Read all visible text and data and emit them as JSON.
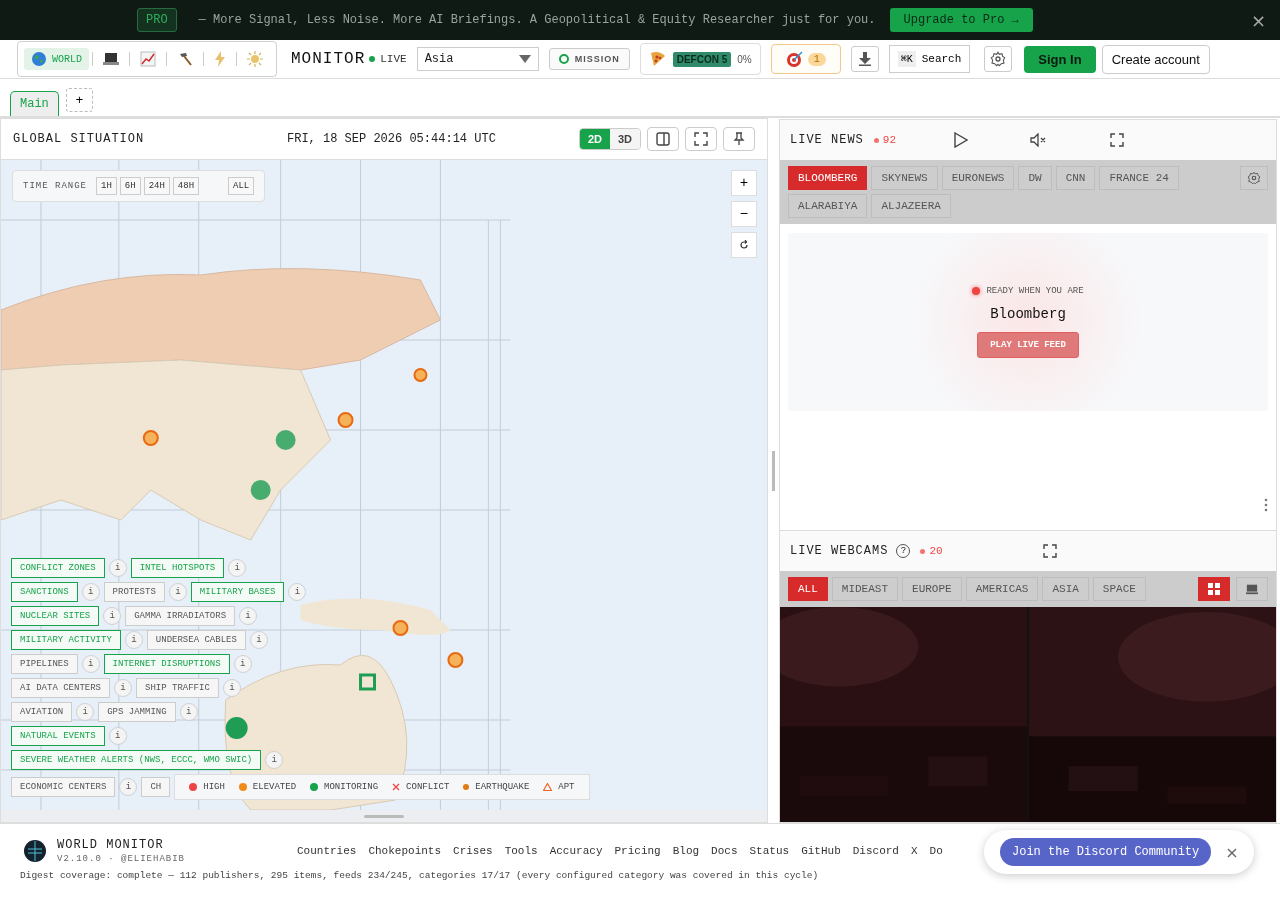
{
  "banner": {
    "badge": "PRO",
    "message": "— More Signal, Less Noise. More AI Briefings. A Geopolitical & Equity Researcher just for you.",
    "cta": "Upgrade to Pro →",
    "close": "×"
  },
  "header": {
    "variants": [
      {
        "kind": "globe",
        "label": "WORLD",
        "selected": true
      },
      {
        "kind": "laptop",
        "selected": false
      },
      {
        "kind": "chart",
        "selected": false
      },
      {
        "kind": "hammer",
        "selected": false
      },
      {
        "kind": "bolt",
        "selected": false
      },
      {
        "kind": "sun",
        "selected": false
      }
    ],
    "brand": "MONITOR",
    "live": "LIVE",
    "region": "Asia",
    "mission": "MISSION",
    "defcon": "DEFCON 5",
    "defcon_pct": "0%",
    "alerts": "1",
    "search_key": "⌘K",
    "search": "Search",
    "sign_in": "Sign In",
    "create_account": "Create account"
  },
  "tabs": [
    {
      "label": "Main",
      "selected": true
    }
  ],
  "add_tab": "+",
  "map_panel": {
    "title": "GLOBAL SITUATION",
    "datetime": "FRI, 18 SEP 2026 05:44:14 UTC",
    "views": [
      {
        "label": "2D",
        "selected": true
      },
      {
        "label": "3D",
        "selected": false
      }
    ],
    "time_range": {
      "label": "TIME RANGE",
      "options": [
        "1H",
        "6H",
        "24H",
        "48H",
        "ALL"
      ]
    },
    "zoom": [
      "+",
      "−"
    ],
    "layer_rows": [
      [
        {
          "label": "CONFLICT ZONES",
          "on": true,
          "info": "i"
        },
        {
          "label": "INTEL HOTSPOTS",
          "on": true,
          "info": "i"
        }
      ],
      [
        {
          "label": "SANCTIONS",
          "on": true,
          "info": "i"
        },
        {
          "label": "PROTESTS",
          "on": false,
          "info": "i"
        },
        {
          "label": "MILITARY BASES",
          "on": true,
          "info": "i"
        }
      ],
      [
        {
          "label": "NUCLEAR SITES",
          "on": true,
          "info": "i"
        },
        {
          "label": "GAMMA IRRADIATORS",
          "on": false,
          "info": "i"
        }
      ],
      [
        {
          "label": "MILITARY ACTIVITY",
          "on": true,
          "info": "i"
        },
        {
          "label": "UNDERSEA CABLES",
          "on": false,
          "info": "i"
        }
      ],
      [
        {
          "label": "PIPELINES",
          "on": false,
          "info": "i"
        },
        {
          "label": "INTERNET DISRUPTIONS",
          "on": true,
          "info": "i"
        }
      ],
      [
        {
          "label": "AI DATA CENTERS",
          "on": false,
          "info": "i"
        },
        {
          "label": "SHIP TRAFFIC",
          "on": false,
          "info": "i"
        }
      ],
      [
        {
          "label": "AVIATION",
          "on": false,
          "info": "i"
        },
        {
          "label": "GPS JAMMING",
          "on": false,
          "info": "i"
        }
      ],
      [
        {
          "label": "NATURAL EVENTS",
          "on": true,
          "info": "i"
        }
      ],
      [
        {
          "label": "SEVERE WEATHER ALERTS (NWS, ECCC, WMO SWIC)",
          "on": true,
          "info": "i"
        }
      ],
      [
        {
          "label": "ECONOMIC CENTERS",
          "on": false,
          "info": "i"
        },
        {
          "label": "CH",
          "on": false
        }
      ]
    ],
    "legend": [
      {
        "kind": "dot",
        "label": "HIGH",
        "color": "#ef4444"
      },
      {
        "kind": "dot",
        "label": "ELEVATED",
        "color": "#f08c1a"
      },
      {
        "kind": "dot",
        "label": "MONITORING",
        "color": "#16a34a"
      },
      {
        "kind": "cross",
        "label": "CONFLICT",
        "color": "#ef4444"
      },
      {
        "kind": "small",
        "label": "EARTHQUAKE",
        "color": "#e07b12"
      },
      {
        "kind": "triangle",
        "label": "APT",
        "color": "#f0622a"
      }
    ]
  },
  "live_news": {
    "title": "LIVE NEWS",
    "count": "92",
    "channels": [
      {
        "label": "BLOOMBERG",
        "selected": true
      },
      {
        "label": "SKYNEWS",
        "selected": false
      },
      {
        "label": "EURONEWS",
        "selected": false
      },
      {
        "label": "DW",
        "selected": false
      },
      {
        "label": "CNN",
        "selected": false
      },
      {
        "label": "FRANCE 24",
        "selected": false
      },
      {
        "label": "ALARABIYA",
        "selected": false
      },
      {
        "label": "ALJAZEERA",
        "selected": false
      }
    ],
    "status": "READY WHEN YOU ARE",
    "channel_name": "Bloomberg",
    "play": "PLAY LIVE FEED"
  },
  "webcams": {
    "title": "LIVE WEBCAMS",
    "help": "?",
    "count": "20",
    "regions": [
      {
        "label": "ALL",
        "selected": true
      },
      {
        "label": "MIDEAST",
        "selected": false
      },
      {
        "label": "EUROPE",
        "selected": false
      },
      {
        "label": "AMERICAS",
        "selected": false
      },
      {
        "label": "ASIA",
        "selected": false
      },
      {
        "label": "SPACE",
        "selected": false
      }
    ],
    "layouts": [
      {
        "kind": "grid",
        "selected": true
      },
      {
        "kind": "single",
        "selected": false
      }
    ]
  },
  "footer": {
    "brand": "WORLD MONITOR",
    "version": "V2.10.0 · @ELIEHABIB",
    "links": [
      "Countries",
      "Chokepoints",
      "Crises",
      "Tools",
      "Accuracy",
      "Pricing",
      "Blog",
      "Docs",
      "Status",
      "GitHub",
      "Discord",
      "X",
      "Do"
    ],
    "digest": "Digest coverage: complete — 112 publishers, 295 items, feeds 234/245, categories 17/17 (every configured category was covered in this cycle)",
    "toast": {
      "label": "Join the Discord Community",
      "close": "×"
    }
  }
}
